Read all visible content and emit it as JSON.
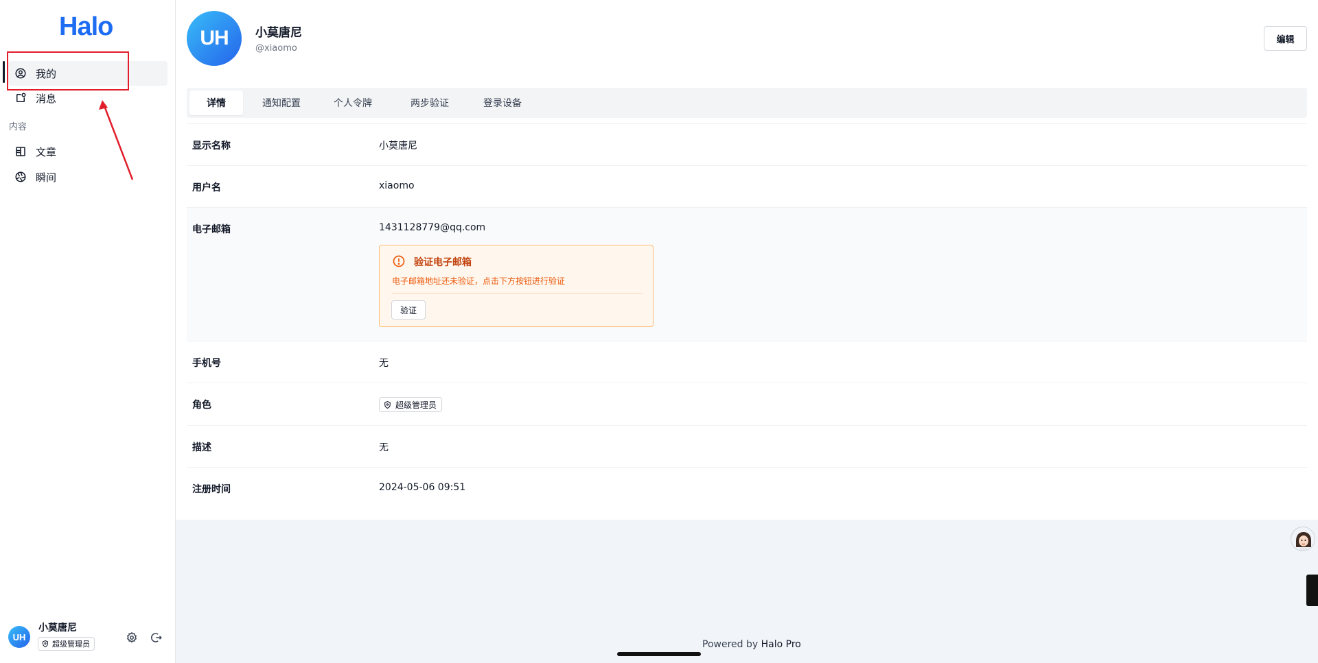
{
  "sidebar": {
    "logo": "Halo",
    "items": [
      {
        "label": "我的",
        "icon": "user-circle-icon",
        "active": true
      },
      {
        "label": "消息",
        "icon": "notification-icon"
      }
    ],
    "group_label": "内容",
    "content_items": [
      {
        "label": "文章",
        "icon": "book-open-icon"
      },
      {
        "label": "瞬间",
        "icon": "aperture-icon"
      }
    ],
    "user": {
      "avatar_text": "UH",
      "name": "小莫唐尼",
      "role": "超级管理员"
    }
  },
  "profile": {
    "avatar_text": "UH",
    "name": "小莫唐尼",
    "handle": "@xiaomo",
    "edit_label": "编辑"
  },
  "tabs": [
    {
      "label": "详情",
      "active": true
    },
    {
      "label": "通知配置"
    },
    {
      "label": "个人令牌"
    },
    {
      "label": "两步验证"
    },
    {
      "label": "登录设备"
    }
  ],
  "details": {
    "display_name": {
      "label": "显示名称",
      "value": "小莫唐尼"
    },
    "username": {
      "label": "用户名",
      "value": "xiaomo"
    },
    "email": {
      "label": "电子邮箱",
      "value": "1431128779@qq.com",
      "verify": {
        "title": "验证电子邮箱",
        "description": "电子邮箱地址还未验证，点击下方按钮进行验证",
        "button": "验证"
      }
    },
    "phone": {
      "label": "手机号",
      "value": "无"
    },
    "role": {
      "label": "角色",
      "value": "超级管理员"
    },
    "description": {
      "label": "描述",
      "value": "无"
    },
    "registered": {
      "label": "注册时间",
      "value": "2024-05-06 09:51"
    }
  },
  "footer": {
    "prefix": "Powered by",
    "brand": "Halo Pro"
  },
  "colors": {
    "brand": "#1d6cf2",
    "annotation": "#e11d2a",
    "warning_text": "#c2410c",
    "warning_bg": "#fff7ed"
  }
}
